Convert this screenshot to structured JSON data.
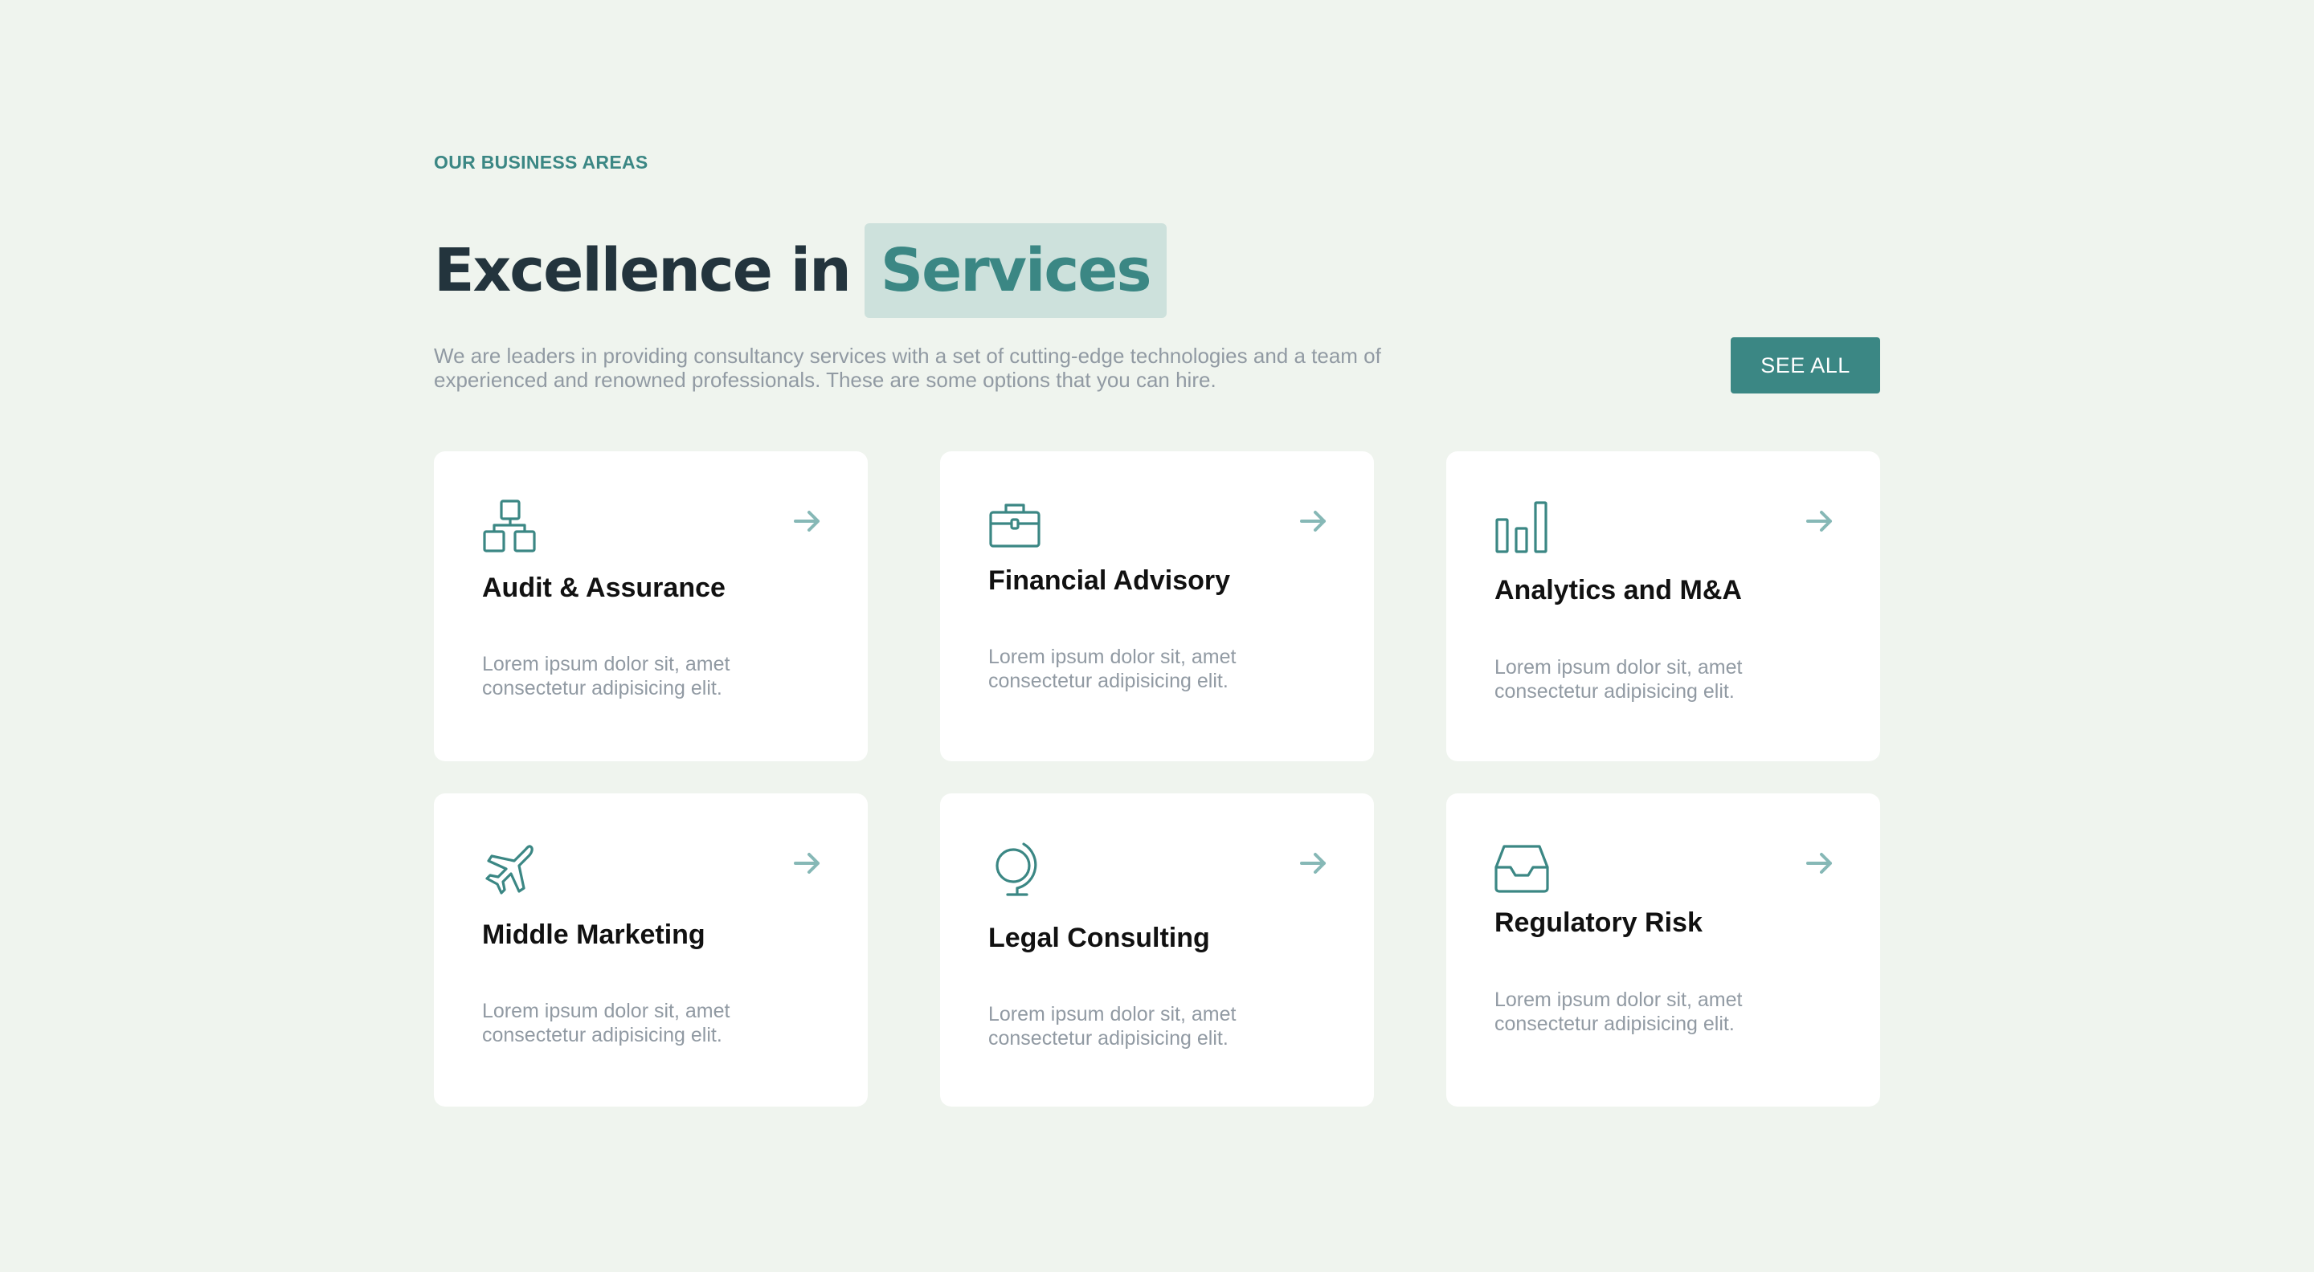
{
  "header": {
    "eyebrow": "OUR BUSINESS AREAS",
    "title_plain": "Excellence in",
    "title_highlight": "Services",
    "intro": "We are leaders in providing consultancy services with a set of cutting-edge technologies and a team of experienced and renowned professionals. These are some options that you can hire.",
    "see_all_label": "SEE ALL"
  },
  "colors": {
    "background": "#eff4ee",
    "accent": "#3b8784",
    "highlight_bg": "#cde1dc",
    "heading": "#23343d",
    "muted_text": "#919aa3",
    "arrow": "#86b8b6"
  },
  "services": [
    {
      "title": "Audit & Assurance",
      "description": "Lorem ipsum dolor sit, amet consectetur adipisicing elit.",
      "icon": "hierarchy-icon"
    },
    {
      "title": "Financial Advisory",
      "description": "Lorem ipsum dolor sit, amet consectetur adipisicing elit.",
      "icon": "briefcase-icon"
    },
    {
      "title": "Analytics and M&A",
      "description": "Lorem ipsum dolor sit, amet consectetur adipisicing elit.",
      "icon": "bar-chart-icon"
    },
    {
      "title": "Middle Marketing",
      "description": "Lorem ipsum dolor sit, amet consectetur adipisicing elit.",
      "icon": "airplane-icon"
    },
    {
      "title": "Legal Consulting",
      "description": "Lorem ipsum dolor sit, amet consectetur adipisicing elit.",
      "icon": "globe-icon"
    },
    {
      "title": "Regulatory Risk",
      "description": "Lorem ipsum dolor sit, amet consectetur adipisicing elit.",
      "icon": "inbox-icon"
    }
  ]
}
